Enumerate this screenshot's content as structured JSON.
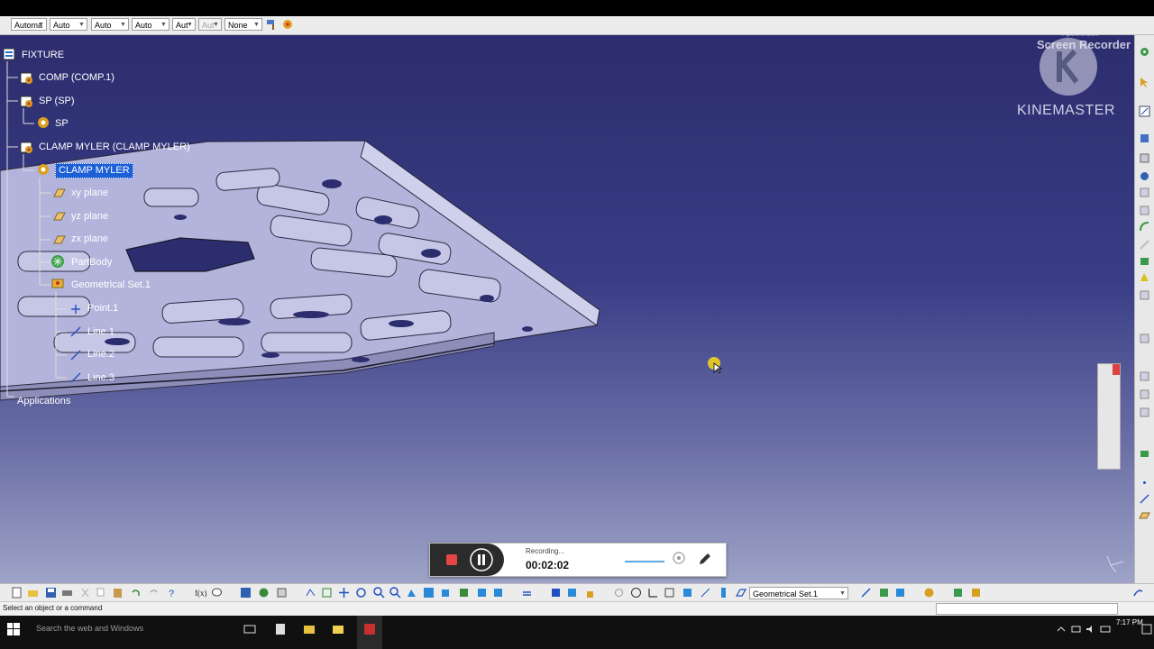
{
  "property_toolbar": {
    "combos": [
      "Automa",
      "Auto",
      "Auto",
      "Auto",
      "Aut",
      "Aut",
      "None"
    ],
    "combo_states": [
      "enabled",
      "enabled",
      "enabled",
      "enabled",
      "enabled",
      "disabled",
      "enabled"
    ]
  },
  "spec_tree": {
    "nodes": [
      {
        "label": "FIXTURE",
        "icon": "product-icon"
      },
      {
        "label": "COMP (COMP.1)",
        "icon": "part-instance-icon"
      },
      {
        "label": "SP (SP)",
        "icon": "part-instance-icon"
      },
      {
        "label": "SP",
        "icon": "part-icon"
      },
      {
        "label": "CLAMP MYLER (CLAMP MYLER)",
        "icon": "part-instance-icon"
      },
      {
        "label": "CLAMP MYLER",
        "icon": "part-icon"
      },
      {
        "label": "xy plane",
        "icon": "plane-icon"
      },
      {
        "label": "yz plane",
        "icon": "plane-icon"
      },
      {
        "label": "zx plane",
        "icon": "plane-icon"
      },
      {
        "label": "PartBody",
        "icon": "body-icon"
      },
      {
        "label": "Geometrical Set.1",
        "icon": "geometrical-set-icon"
      },
      {
        "label": "Point.1",
        "icon": "point-icon"
      },
      {
        "label": "Line.1",
        "icon": "line-icon"
      },
      {
        "label": "Line.2",
        "icon": "line-icon"
      },
      {
        "label": "Line.3",
        "icon": "line-icon"
      },
      {
        "label": "Applications",
        "icon": "applications-icon"
      }
    ],
    "selected_label": "CLAMP MYLER"
  },
  "watermarks": {
    "recorder_small": "Apowersoft",
    "recorder": "Screen Recorder",
    "kinemaster": "KINEMASTER"
  },
  "recording": {
    "status": "Recording...",
    "time": "00:02:02"
  },
  "bottom_toolbar": {
    "geometry_combo": "Geometrical Set.1"
  },
  "status_bar": {
    "text": "Select an object or a command"
  },
  "taskbar": {
    "search_placeholder": "Search the web and Windows",
    "time": "7:17 PM"
  },
  "colors": {
    "viewport_top": "#2c2d6e",
    "viewport_bottom": "#9ea3c7",
    "selection": "#1c5fd6",
    "record_red": "#e64545"
  }
}
